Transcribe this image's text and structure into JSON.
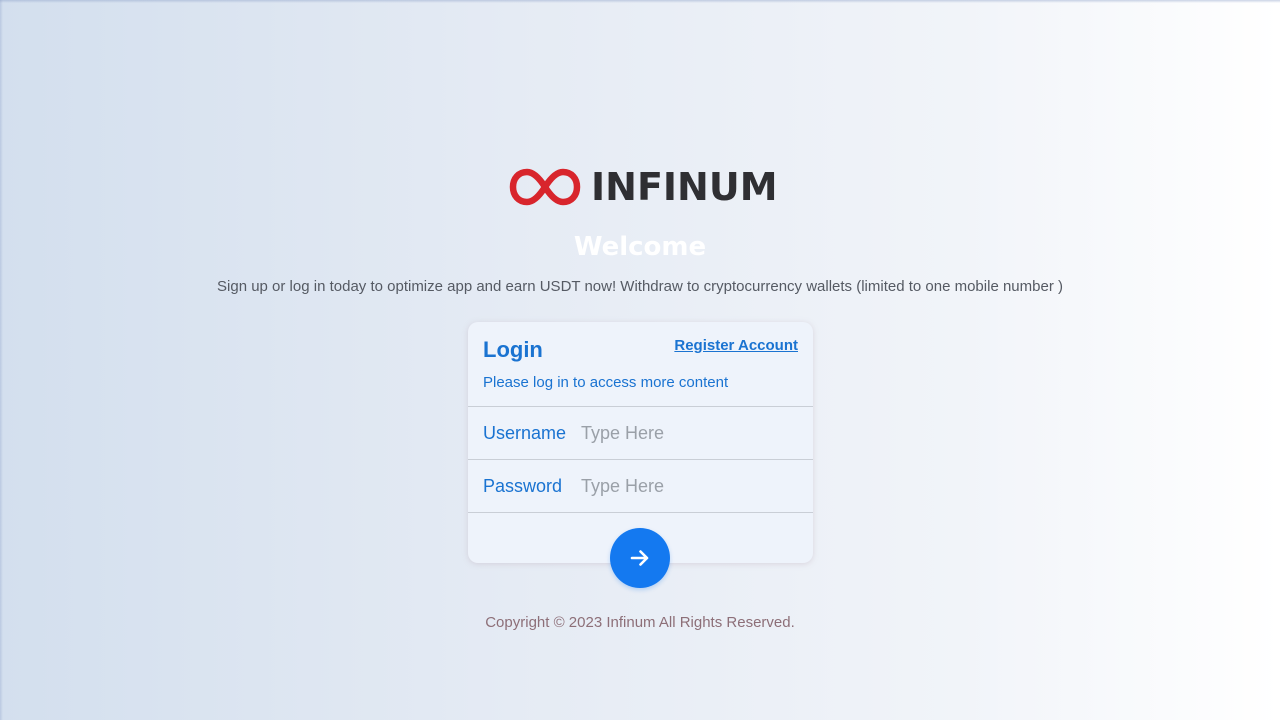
{
  "brand": {
    "name": "INFINUM",
    "logo_icon": "infinity-icon",
    "logo_color": "#d8252c",
    "text_color": "#2f2f33"
  },
  "welcome": {
    "title": "Welcome",
    "tagline": "Sign up or log in today to optimize app and earn USDT now! Withdraw to cryptocurrency wallets (limited to one mobile number )"
  },
  "login_card": {
    "title": "Login",
    "register_link": "Register Account",
    "subtitle": "Please log in to access more content",
    "fields": {
      "username": {
        "label": "Username",
        "placeholder": "Type Here",
        "value": ""
      },
      "password": {
        "label": "Password",
        "placeholder": "Type Here",
        "value": ""
      }
    },
    "submit_icon": "arrow-right-icon",
    "accent_color": "#1479f0"
  },
  "footer": {
    "copyright": "Copyright © 2023 Infinum All Rights Reserved."
  }
}
